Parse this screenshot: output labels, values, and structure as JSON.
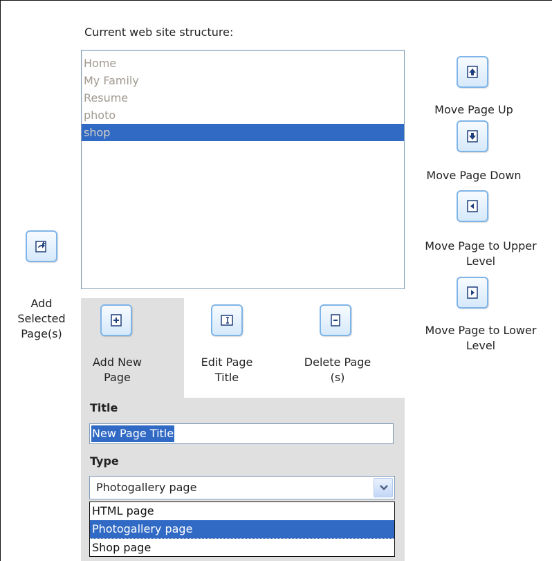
{
  "header": {
    "structure_label": "Current web site structure:"
  },
  "site_structure": {
    "pages": [
      {
        "label": "Home",
        "selected": false
      },
      {
        "label": "My Family",
        "selected": false
      },
      {
        "label": "Resume",
        "selected": false
      },
      {
        "label": "photo",
        "selected": false
      },
      {
        "label": "shop",
        "selected": true
      }
    ]
  },
  "left_actions": {
    "add_selected_label": "Add Selected Page(s)",
    "add_selected_icon": "add-selected-page-icon"
  },
  "right_actions": {
    "move_up_label": "Move Page Up",
    "move_down_label": "Move Page Down",
    "move_upper_level_label": "Move Page to Upper Level",
    "move_lower_level_label": "Move Page to Lower Level"
  },
  "tabs": {
    "add_new_label": "Add New Page",
    "edit_title_label": "Edit Page Title",
    "delete_label": "Delete Page (s)",
    "active": "add_new"
  },
  "form": {
    "title_label": "Title",
    "title_value": "New Page Title",
    "type_label": "Type",
    "type_selected": "Photogallery page",
    "type_options": [
      "HTML page",
      "Photogallery page",
      "Shop page"
    ]
  },
  "colors": {
    "selection": "#316ac5",
    "button_border": "#7fb4e8",
    "panel_bg": "#e0e0e0",
    "list_text": "#a09a90"
  }
}
